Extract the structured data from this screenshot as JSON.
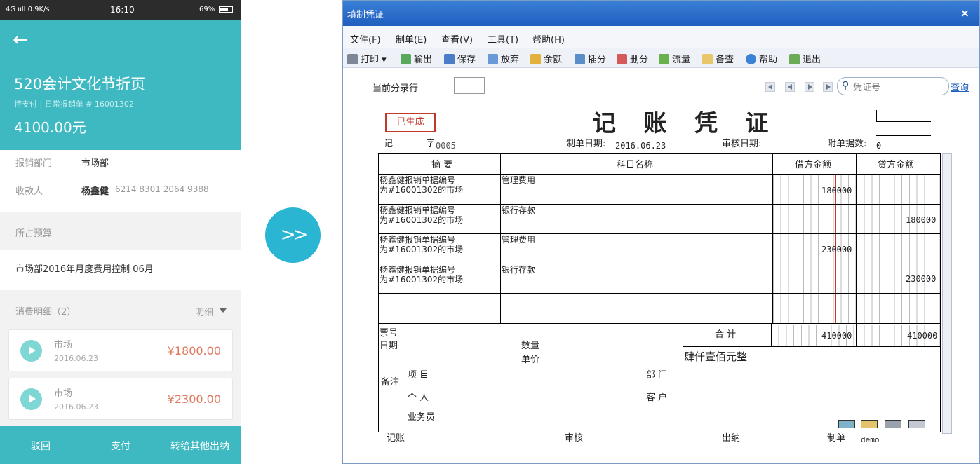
{
  "phone": {
    "status": {
      "network": "4G ııll 0.9K/s",
      "time": "16:10",
      "battery": "69%"
    },
    "title": "520会计文化节折页",
    "subtitle": "待支付 | 日常报销单 # 16001302",
    "amount": "4100.00元",
    "dept_label": "报销部门",
    "dept_value": "市场部",
    "payee_label": "收款人",
    "payee_name": "杨鑫健",
    "payee_account": "6214 8301 2064 9388",
    "budget_label": "所占预算",
    "budget_value": "市场部2016年月度费用控制 06月",
    "expense_label": "消费明细（2）",
    "detail_label": "明细",
    "expenses": [
      {
        "name": "市场",
        "date": "2016.06.23",
        "amount": "¥1800.00"
      },
      {
        "name": "市场",
        "date": "2016.06.23",
        "amount": "¥2300.00"
      }
    ],
    "actions": {
      "reject": "驳回",
      "pay": "支付",
      "transfer": "转给其他出纳"
    }
  },
  "arrow_glyph": ">>",
  "window": {
    "title": "填制凭证",
    "close": "×",
    "menu": [
      "文件(F)",
      "制单(E)",
      "查看(V)",
      "工具(T)",
      "帮助(H)"
    ],
    "toolbar": [
      "打印",
      "输出",
      "保存",
      "放弃",
      "余额",
      "插分",
      "删分",
      "流量",
      "备查",
      "帮助",
      "退出"
    ],
    "current_entry_label": "当前分录行",
    "search_placeholder": "凭证号",
    "query": "查询"
  },
  "voucher": {
    "stamp": "已生成",
    "title": "记 账 凭 证",
    "type": "记",
    "zi_label": "字",
    "number": "0005",
    "date_label": "制单日期:",
    "date": "2016.06.23",
    "audit_date_label": "审核日期:",
    "attach_label": "附单据数:",
    "attach_count": "0",
    "headers": {
      "summary": "摘  要",
      "account": "科目名称",
      "debit": "借方金额",
      "credit": "贷方金额"
    },
    "rows": [
      {
        "summary1": "杨鑫健报销单据编号",
        "summary2": "为#16001302的市场",
        "account": "管理费用",
        "debit": "180000",
        "credit": ""
      },
      {
        "summary1": "杨鑫健报销单据编号",
        "summary2": "为#16001302的市场",
        "account": "银行存款",
        "debit": "",
        "credit": "180000"
      },
      {
        "summary1": "杨鑫健报销单据编号",
        "summary2": "为#16001302的市场",
        "account": "管理费用",
        "debit": "230000",
        "credit": ""
      },
      {
        "summary1": "杨鑫健报销单据编号",
        "summary2": "为#16001302的市场",
        "account": "银行存款",
        "debit": "",
        "credit": "230000"
      }
    ],
    "ticket_label": "票号",
    "date_field_label": "日期",
    "qty_label": "数量",
    "unit_price_label": "单价",
    "total_label": "合 计",
    "total_debit": "410000",
    "total_credit": "410000",
    "total_words": "肆仟壹佰元整",
    "remark_label": "备注",
    "project_label": "项  目",
    "dept_label": "部  门",
    "person_label": "个  人",
    "customer_label": "客  户",
    "salesman_label": "业务员",
    "bookkeeper_label": "记账",
    "auditor_label": "审核",
    "cashier_label": "出纳",
    "maker_label": "制单",
    "maker": "demo"
  }
}
